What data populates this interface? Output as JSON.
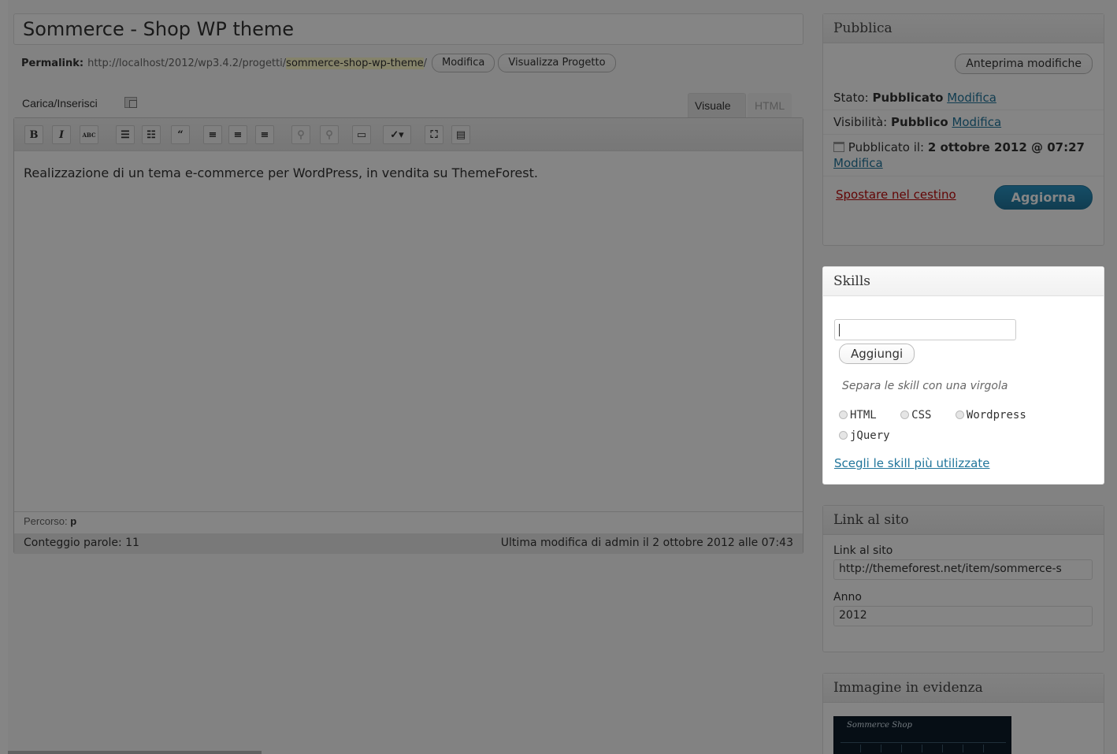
{
  "post": {
    "title": "Sommerce - Shop WP theme",
    "permalink_label": "Permalink:",
    "permalink_base": "http://localhost/2012/wp3.4.2/progetti/",
    "permalink_slug": "sommerce-shop-wp-theme",
    "permalink_tail": "/",
    "edit_button": "Modifica",
    "view_button": "Visualizza Progetto"
  },
  "editor": {
    "media_label": "Carica/Inserisci",
    "tab_visual": "Visuale",
    "tab_html": "HTML",
    "toolbar": [
      {
        "name": "bold-icon",
        "label": "B",
        "disabled": false
      },
      {
        "name": "italic-icon",
        "label": "I",
        "disabled": false
      },
      {
        "name": "strikethrough-icon",
        "label": "ABC",
        "disabled": false
      },
      {
        "name": "bullet-list-icon",
        "label": "☰",
        "disabled": false
      },
      {
        "name": "numbered-list-icon",
        "label": "☷",
        "disabled": false
      },
      {
        "name": "blockquote-icon",
        "label": "“",
        "disabled": false
      },
      {
        "name": "align-left-icon",
        "label": "≡",
        "disabled": false
      },
      {
        "name": "align-center-icon",
        "label": "≡",
        "disabled": false
      },
      {
        "name": "align-right-icon",
        "label": "≡",
        "disabled": false
      },
      {
        "name": "insert-link-icon",
        "label": "⚲",
        "disabled": true
      },
      {
        "name": "unlink-icon",
        "label": "⚲",
        "disabled": true
      },
      {
        "name": "more-tag-icon",
        "label": "▭",
        "disabled": false
      },
      {
        "name": "spellcheck-icon",
        "label": "✓▾",
        "disabled": false
      },
      {
        "name": "fullscreen-icon",
        "label": "⛶",
        "disabled": false
      },
      {
        "name": "kitchen-sink-icon",
        "label": "▤",
        "disabled": false
      }
    ],
    "content": "Realizzazione di un tema e-commerce per WordPress, in vendita su ThemeForest.",
    "path_label": "Percorso:",
    "path_value": "p",
    "word_count": "Conteggio parole: 11",
    "last_edit": "Ultima modifica di admin il 2 ottobre 2012 alle 07:43"
  },
  "publish": {
    "title": "Pubblica",
    "preview_button": "Anteprima modifiche",
    "status_label": "Stato:",
    "status_value": "Pubblicato",
    "visibility_label": "Visibilità:",
    "visibility_value": "Pubblico",
    "published_label": "Pubblicato il:",
    "published_value": "2 ottobre 2012 @ 07:27",
    "edit_link": "Modifica",
    "trash_link": "Spostare nel cestino",
    "update_button": "Aggiorna"
  },
  "skills": {
    "title": "Skills",
    "input_value": "",
    "add_button": "Aggiungi",
    "hint": "Separa le skill con una virgola",
    "tags": [
      "HTML",
      "CSS",
      "Wordpress",
      "jQuery"
    ],
    "most_used_link": "Scegli le skill più utilizzate"
  },
  "site_link": {
    "title": "Link al sito",
    "url_label": "Link al sito",
    "url_value": "http://themeforest.net/item/sommerce-s",
    "year_label": "Anno",
    "year_value": "2012"
  },
  "featured": {
    "title": "Immagine in evidenza",
    "thumb_title": "Sommerce Shop"
  },
  "colors": {
    "link": "#21759b",
    "primary_button": "#21759b",
    "trash": "#bc0b0b",
    "slug_highlight": "#fffbcc"
  }
}
